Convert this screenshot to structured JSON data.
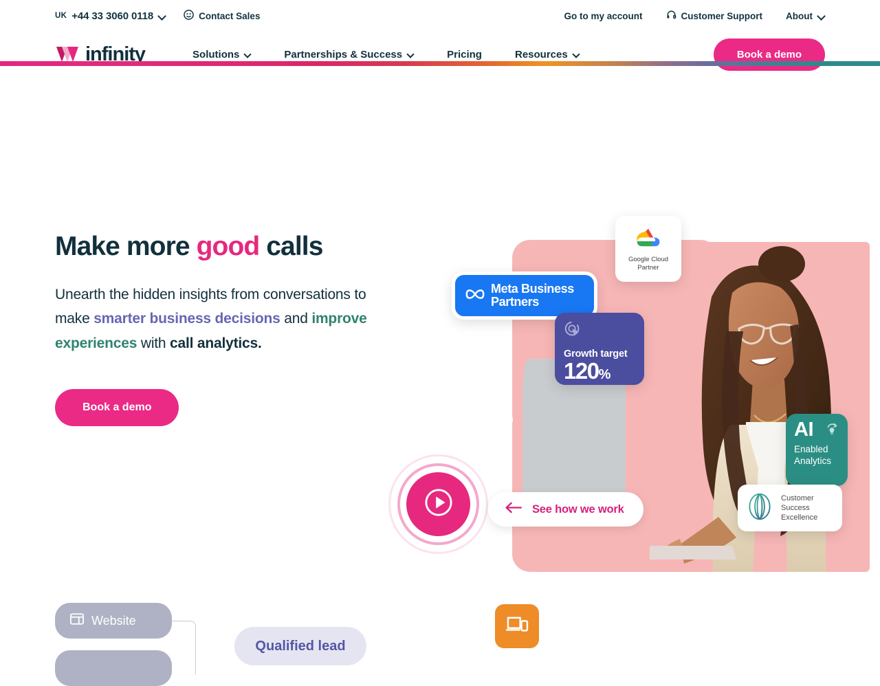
{
  "utility_bar": {
    "country_code": "UK",
    "phone": "+44 33 3060 0118",
    "phone_chevron_icon": "chevron-down-icon",
    "contact_sales": {
      "label": "Contact Sales",
      "icon": "contact-person-icon"
    },
    "go_to_my_account": "Go to my account",
    "customer_support": {
      "label": "Customer Support",
      "icon": "headset-support-icon"
    },
    "about": {
      "label": "About",
      "icon": "chevron-down-icon"
    }
  },
  "main_nav": {
    "logo_text": "infinity",
    "logo_mark_icon": "infinity-logo-icon",
    "links": [
      {
        "label": "Solutions",
        "has_dropdown": true
      },
      {
        "label": "Partnerships & Success",
        "has_dropdown": true
      },
      {
        "label": "Pricing",
        "has_dropdown": false
      },
      {
        "label": "Resources",
        "has_dropdown": true
      }
    ],
    "cta_label": "Book a demo"
  },
  "decor": {
    "gradient_rule_colors": [
      "#E42780",
      "#D63A50",
      "#EE9424",
      "#6C6D9E",
      "#2E8C8C"
    ]
  },
  "hero": {
    "title_part1": "Make more ",
    "title_highlight": "good",
    "title_part2": " calls",
    "sub_1": "Unearth the hidden insights from conversations to make ",
    "sub_purple": "smarter business decisions",
    "sub_2": " and ",
    "sub_teal": "improve experiences",
    "sub_3": " with ",
    "sub_bold": "call analytics.",
    "cta_label": "Book a demo",
    "play_button_icon": "play-icon",
    "see_how_label": "See how we work",
    "see_how_icon": "arrow-left-icon"
  },
  "badges": {
    "google_cloud": {
      "line1": "Google Cloud",
      "line2": "Partner",
      "icon": "google-cloud-icon"
    },
    "meta": {
      "line1": "Meta Business",
      "line2": "Partners",
      "icon": "meta-infinity-icon"
    },
    "growth": {
      "label": "Growth target",
      "value": "120",
      "unit": "%",
      "icon": "target-cursor-icon"
    },
    "ai": {
      "big": "AI",
      "line1": "Enabled",
      "line2": "Analytics",
      "icon": "ai-lightbulb-icon"
    },
    "customer_success": {
      "line1": "Customer",
      "line2": "Success",
      "line3": "Excellence",
      "icon": "customer-success-globe-icon"
    }
  },
  "flow": {
    "website_chip": {
      "label": "Website",
      "icon": "web-layout-icon"
    },
    "qualified_chip": {
      "label": "Qualified lead"
    },
    "device_icon": "devices-icon"
  },
  "colors": {
    "brand_pink": "#EB2A86",
    "deep_navy": "#12303C",
    "purple": "#6666B3",
    "teal": "#30836F",
    "orange": "#EE8C28",
    "panel_pink": "#F7B6B6"
  }
}
